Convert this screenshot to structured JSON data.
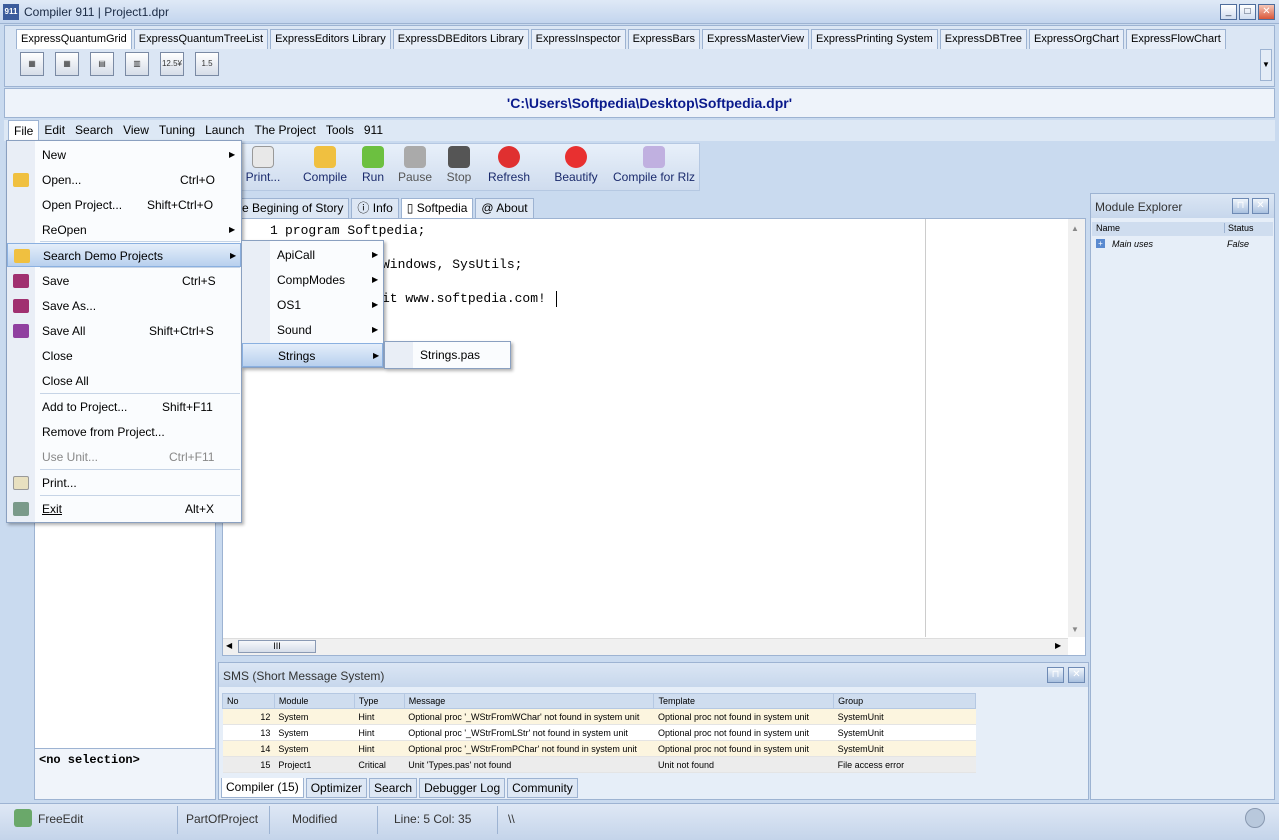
{
  "window": {
    "title": "Compiler 911 | Project1.dpr",
    "app_icon": "911"
  },
  "ribbon": {
    "tabs": [
      "ExpressQuantumGrid",
      "ExpressQuantumTreeList",
      "ExpressEditors Library",
      "ExpressDBEditors Library",
      "ExpressInspector",
      "ExpressBars",
      "ExpressMasterView",
      "ExpressPrinting System",
      "ExpressDBTree",
      "ExpressOrgChart",
      "ExpressFlowChart"
    ],
    "icon_2": "12.5¥",
    "icon_3": "1.5"
  },
  "path": "'C:\\Users\\Softpedia\\Desktop\\Softpedia.dpr'",
  "menubar": [
    "File",
    "Edit",
    "Search",
    "View",
    "Tuning",
    "Launch",
    "The Project",
    "Tools",
    "911"
  ],
  "toolbar": {
    "print": "Print...",
    "compile": "Compile",
    "run": "Run",
    "pause": "Pause",
    "stop": "Stop",
    "refresh": "Refresh",
    "beautify": "Beautify",
    "compile_rlz": "Compile for Rlz"
  },
  "editor_tabs": [
    "The Begining of Story",
    "Info",
    "Softpedia",
    "About"
  ],
  "code": {
    "line1_no": "1",
    "line1": "program Softpedia;",
    "line2": "Windows, SysUtils;",
    "line3": "it www.softpedia.com!"
  },
  "hscroll_thumb": "III",
  "module_explorer": {
    "title": "Module Explorer",
    "cols": [
      "Name",
      "Status"
    ],
    "row_name": "Main uses",
    "row_status": "False"
  },
  "sms": {
    "title": "SMS (Short Message System)",
    "cols": [
      "No",
      "Module",
      "Type",
      "Message",
      "Template",
      "Group"
    ],
    "rows": [
      [
        "12",
        "System",
        "Hint",
        "Optional proc '_WStrFromWChar' not found in system unit",
        "Optional proc not found in system unit",
        "SystemUnit"
      ],
      [
        "13",
        "System",
        "Hint",
        "Optional proc '_WStrFromLStr' not found in system unit",
        "Optional proc not found in system unit",
        "SystemUnit"
      ],
      [
        "14",
        "System",
        "Hint",
        "Optional proc '_WStrFromPChar' not found in system unit",
        "Optional proc not found in system unit",
        "SystemUnit"
      ],
      [
        "15",
        "Project1",
        "Critical",
        "Unit 'Types.pas' not found",
        "Unit not found",
        "File access error"
      ]
    ],
    "tabs": [
      "Compiler (15)",
      "Optimizer",
      "Search",
      "Debugger Log",
      "Community"
    ]
  },
  "left_panel": {
    "selection": "<no selection>"
  },
  "status": {
    "edit": "FreeEdit",
    "part": "PartOfProject",
    "modified": "Modified",
    "pos": "Line: 5 Col: 35",
    "sep": "\\\\"
  },
  "file_menu": [
    {
      "label": "New",
      "shortcut": ""
    },
    {
      "label": "Open...",
      "shortcut": "Ctrl+O"
    },
    {
      "label": "Open Project...",
      "shortcut": "Shift+Ctrl+O"
    },
    {
      "label": "ReOpen",
      "shortcut": ""
    },
    {
      "label": "Search Demo Projects",
      "shortcut": ""
    },
    {
      "label": "Save",
      "shortcut": "Ctrl+S"
    },
    {
      "label": "Save As...",
      "shortcut": ""
    },
    {
      "label": "Save All",
      "shortcut": "Shift+Ctrl+S"
    },
    {
      "label": "Close",
      "shortcut": ""
    },
    {
      "label": "Close All",
      "shortcut": ""
    },
    {
      "label": "Add to Project...",
      "shortcut": "Shift+F11"
    },
    {
      "label": "Remove from Project...",
      "shortcut": ""
    },
    {
      "label": "Use Unit...",
      "shortcut": "Ctrl+F11"
    },
    {
      "label": "Print...",
      "shortcut": ""
    },
    {
      "label": "Exit",
      "shortcut": "Alt+X"
    }
  ],
  "demo_submenu": [
    "ApiCall",
    "CompModes",
    "OS1",
    "Sound",
    "Strings"
  ],
  "strings_submenu": [
    "Strings.pas"
  ]
}
